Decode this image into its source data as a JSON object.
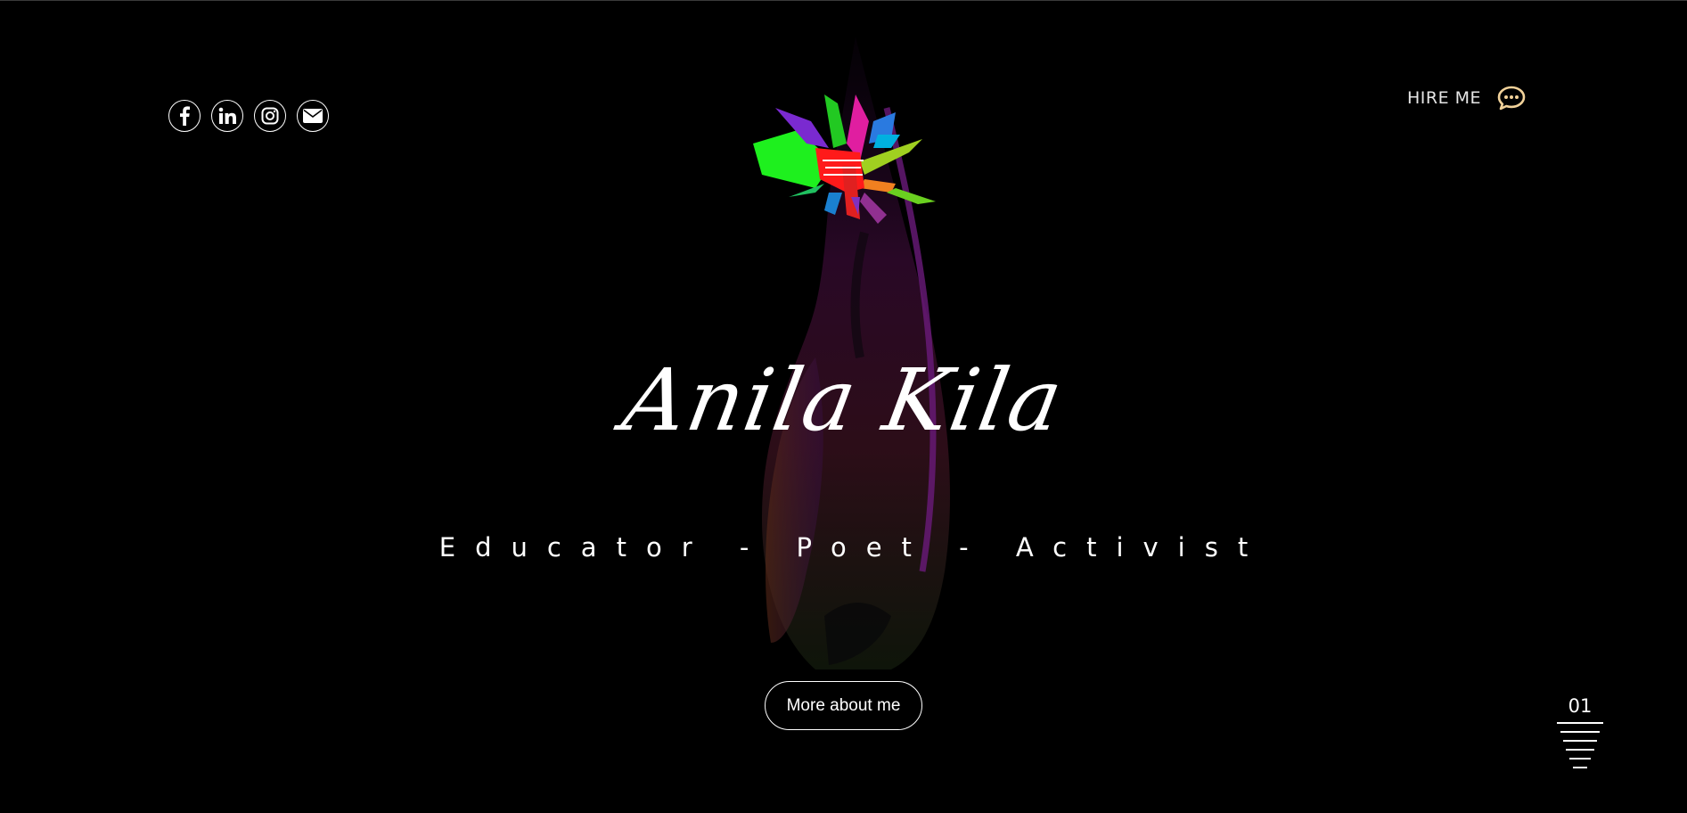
{
  "header": {
    "socials": [
      {
        "icon": "facebook-icon"
      },
      {
        "icon": "linkedin-icon"
      },
      {
        "icon": "instagram-icon"
      },
      {
        "icon": "email-icon"
      }
    ],
    "hire_label": "HIRE ME",
    "hire_icon": "chat-bubble-icon"
  },
  "hero": {
    "name": "Anila Kila",
    "tagline": "Educator - Poet - Activist",
    "about_button": "More about me"
  },
  "pager": {
    "current": "01"
  },
  "colors": {
    "background": "#000000",
    "text": "#ffffff",
    "accent": "#f2d29a"
  }
}
